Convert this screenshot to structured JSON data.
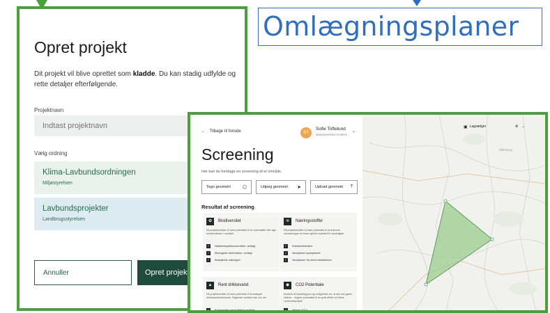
{
  "headline": "Omlægningsplaner",
  "opret": {
    "heading": "Opret projekt",
    "desc_part1": "Dit projekt vil blive oprettet som ",
    "desc_bold": "kladde",
    "desc_part2": ". Du kan stadig udfylde og rette detaljer efterfølgende.",
    "name_label": "Projektnavn",
    "name_placeholder": "Indtast projektnavn",
    "ordning_label": "Vælg ordning",
    "options": [
      {
        "title": "Klima-Lavbundsordningen",
        "sub": "Miljøstyrelsen"
      },
      {
        "title": "Lavbundsprojekter",
        "sub": "Landbrugsstyrelsen"
      }
    ],
    "cancel_label": "Annuller",
    "create_label": "Opret projekt"
  },
  "screening": {
    "back_label": "Tilbage til forside",
    "user": {
      "initials": "ST",
      "name": "Sofie Toftelund",
      "org": "Naturstyrelsen Kontrol..."
    },
    "heading": "Screening",
    "desc": "Her kan du foretage en screening af et område.",
    "tools": [
      {
        "label": "Tegn geometri",
        "icon": "polygon-icon"
      },
      {
        "label": "Udpeg geometri",
        "icon": "cursor-icon"
      },
      {
        "label": "Upload geometri",
        "icon": "upload-icon"
      }
    ],
    "result_title": "Resultat af screening",
    "cards": [
      {
        "title": "Biodiversitet",
        "icon": "leaf-icon",
        "desc": "Dit projektområde vil have potentiale til at understøtte eller øge biodiversiteten i området.",
        "items": [
          "Naturbeskyttelsesområder, vedlagt",
          "Økologiske forbindelser, vedlagt",
          "Beskyttede naturtyper"
        ]
      },
      {
        "title": "Næringsstoffer",
        "icon": "nutrient-icon",
        "desc": "Dit projektområde vil have potentiale til at reducere udvaskningen af fosfor og/eller kvælstof til vandmiljøet.",
        "items": [
          "Kvælstofretention",
          "Vandplaner kystoplande",
          "Vandplaner Sø med indsatsbehov"
        ]
      },
      {
        "title": "Rent drikkevand",
        "icon": "water-icon",
        "desc": "Dit projektområde vil have potentiale til at beskytte drikkevandsinteresser. Følgende områder kan ses her.",
        "items": [
          "Boringsnære beskyttelsesområder"
        ]
      },
      {
        "title": "CO2 Potentiale",
        "icon": "diamond-icon",
        "desc": "Andelen af kulstofrig jord og muligheden for, at den kan gøres vådere... angiver potentialet til at opnå effekt i et Klima-Lavbundsprojekt.",
        "items": [
          "Tekstur 2014"
        ]
      }
    ]
  },
  "map": {
    "layer_label": "Lagvælger",
    "fill_color": "#9ccc8e",
    "stroke_color": "#5a9a63"
  }
}
